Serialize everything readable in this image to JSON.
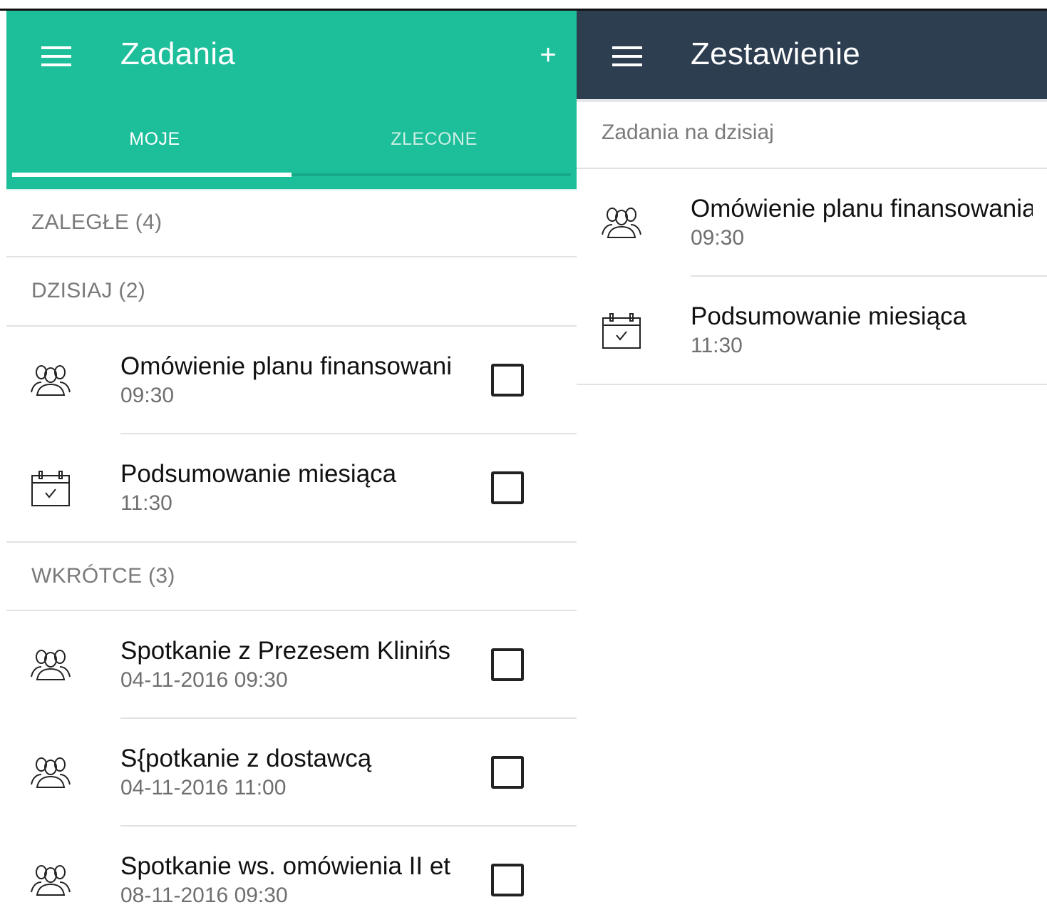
{
  "tasks_screen": {
    "title": "Zadania",
    "menu_icon": "hamburger-menu-icon",
    "add_icon": "plus-icon",
    "add_glyph": "+",
    "tabs": [
      {
        "label": "MOJE",
        "active": true
      },
      {
        "label": "ZLECONE",
        "active": false
      }
    ],
    "sections": {
      "overdue": {
        "label": "ZALEGŁE (4)"
      },
      "today": {
        "label": "DZISIAJ (2)",
        "items": [
          {
            "icon": "people-icon",
            "title": "Omówienie planu finansowania",
            "time": "09:30",
            "checked": false
          },
          {
            "icon": "calendar-check-icon",
            "title": "Podsumowanie miesiąca",
            "time": "11:30",
            "checked": false
          }
        ]
      },
      "upcoming": {
        "label": "WKRÓTCE (3)",
        "items": [
          {
            "icon": "people-icon",
            "title": "Spotkanie z Prezesem Klinińskim",
            "time": "04-11-2016 09:30",
            "checked": false
          },
          {
            "icon": "people-icon",
            "title": "S{potkanie z dostawcą",
            "time": "04-11-2016 11:00",
            "checked": false
          },
          {
            "icon": "people-icon",
            "title": "Spotkanie ws. omówienia II etapu",
            "time": "08-11-2016 09:30",
            "checked": false
          }
        ]
      }
    }
  },
  "summary_screen": {
    "title": "Zestawienie",
    "menu_icon": "hamburger-menu-icon",
    "section_label": "Zadania na dzisiaj",
    "items": [
      {
        "icon": "people-icon",
        "title": "Omówienie planu finansowania",
        "time": "09:30"
      },
      {
        "icon": "calendar-check-icon",
        "title": "Podsumowanie miesiąca",
        "time": "11:30"
      }
    ]
  },
  "colors": {
    "tasks_appbar": "#1dbf9b",
    "summary_appbar": "#2e3e51",
    "section_label": "#7a7a7a",
    "secondary_text": "#6f6f6f"
  }
}
